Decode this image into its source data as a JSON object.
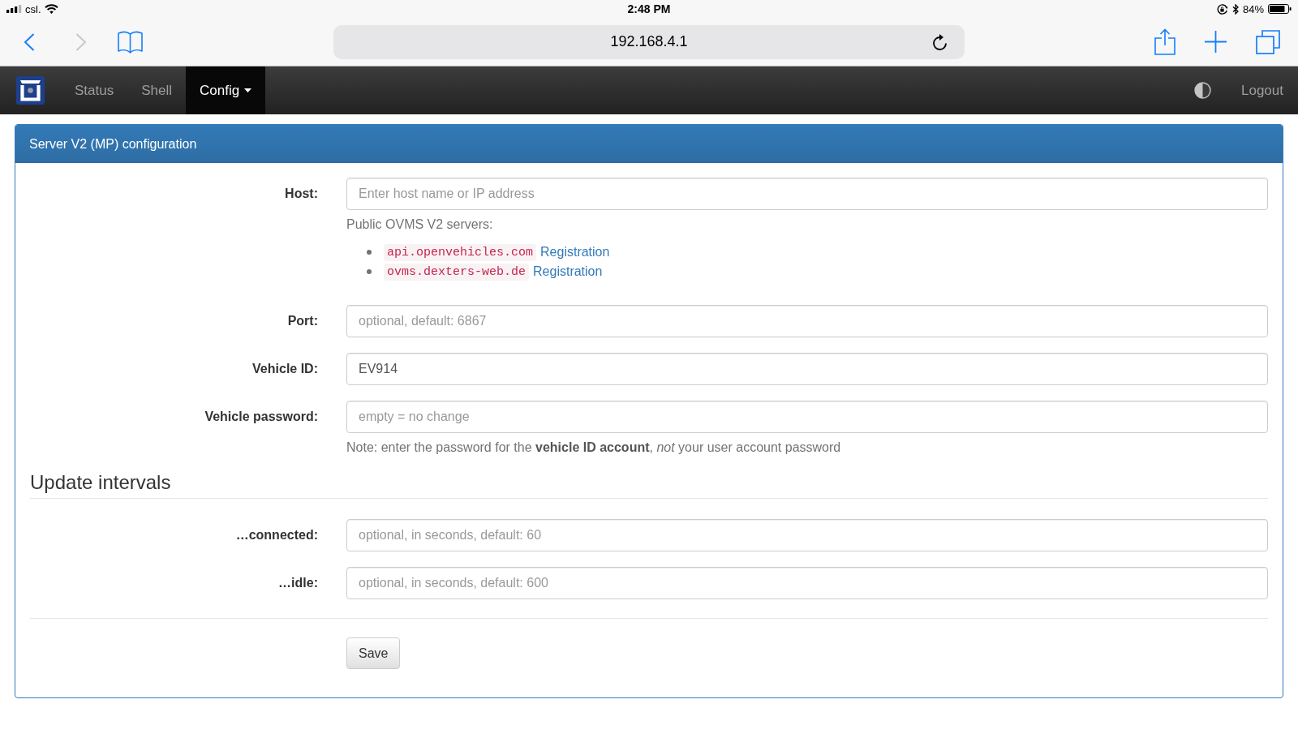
{
  "status_bar": {
    "carrier": "csl.",
    "time": "2:48 PM",
    "battery": "84%"
  },
  "browser": {
    "nav_buttons": [
      {
        "kind": "back",
        "disabled": false
      },
      {
        "kind": "forward",
        "disabled": true
      }
    ],
    "address": "192.168.4.1"
  },
  "navbar": {
    "items": [
      {
        "label": "Status",
        "selected": false,
        "dropdown": false
      },
      {
        "label": "Shell",
        "selected": false,
        "dropdown": false
      },
      {
        "label": "Config",
        "selected": true,
        "dropdown": true
      }
    ],
    "logout": "Logout"
  },
  "panel": {
    "title": "Server V2 (MP) configuration",
    "server_fields": [
      {
        "label": "Host:",
        "placeholder": "Enter host name or IP address",
        "help": "Public OVMS V2 servers:",
        "servers": [
          {
            "host": "api.openvehicles.com",
            "link": "Registration"
          },
          {
            "host": "ovms.dexters-web.de",
            "link": "Registration"
          }
        ]
      },
      {
        "label": "Port:",
        "placeholder": "optional, default: 6867"
      },
      {
        "label": "Vehicle ID:",
        "value": "EV914"
      },
      {
        "label": "Vehicle password:",
        "placeholder": "empty = no change",
        "help": "Note: enter the password for the **vehicle ID account**, *not* your user account password"
      }
    ],
    "section_title": "Update intervals",
    "interval_fields": [
      {
        "label": "…connected:",
        "placeholder": "optional, in seconds, default: 60"
      },
      {
        "label": "…idle:",
        "placeholder": "optional, in seconds, default: 600"
      }
    ],
    "save_button": "Save"
  }
}
